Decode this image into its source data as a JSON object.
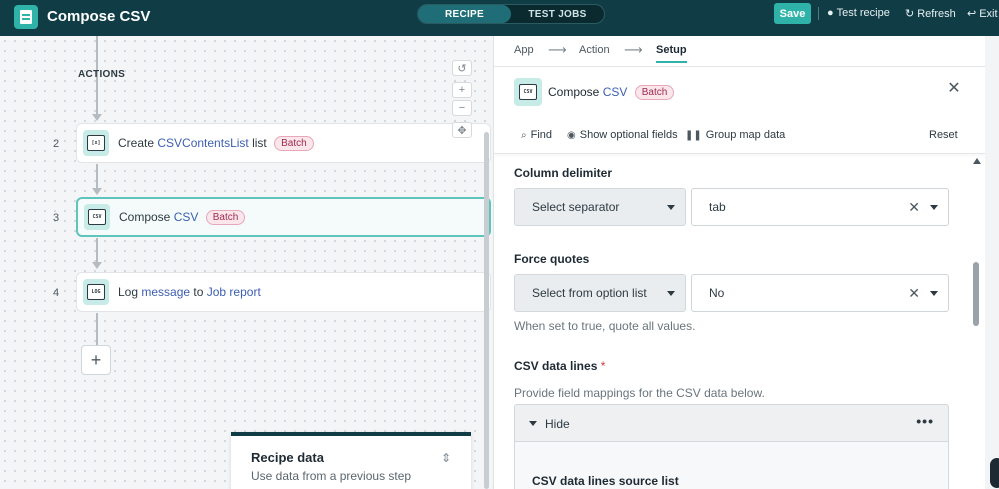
{
  "topbar": {
    "title": "Compose CSV",
    "modes": [
      "RECIPE",
      "TEST JOBS"
    ],
    "active_mode": "RECIPE",
    "save_label": "Save",
    "test_recipe": "Test recipe",
    "refresh": "Refresh",
    "exit": "Exit"
  },
  "canvas": {
    "section_label": "ACTIONS",
    "steps": [
      {
        "num": "2",
        "prefix": "Create ",
        "highlight": "CSVContentsList",
        "suffix": " list",
        "badge": "Batch",
        "icon_text": "[x]"
      },
      {
        "num": "3",
        "prefix": "Compose ",
        "highlight": "CSV",
        "suffix": "",
        "badge": "Batch",
        "icon_text": "CSV"
      },
      {
        "num": "4",
        "prefix": "Log ",
        "highlight": "message",
        "middle": " to ",
        "highlight2": "Job report",
        "icon_text": "LOG"
      }
    ],
    "add_label": "+",
    "recipe_data": {
      "title": "Recipe data",
      "subtitle": "Use data from a previous step"
    }
  },
  "panel": {
    "breadcrumbs": [
      "App",
      "Action",
      "Setup"
    ],
    "active_crumb": "Setup",
    "header": {
      "prefix": "Compose ",
      "highlight": "CSV",
      "badge": "Batch"
    },
    "tools": {
      "find": "Find",
      "optional": "Show optional fields",
      "group": "Group map data",
      "reset": "Reset"
    },
    "fields": {
      "column_delimiter": {
        "label": "Column delimiter",
        "mode": "Select separator",
        "value": "tab"
      },
      "force_quotes": {
        "label": "Force quotes",
        "mode": "Select from option list",
        "value": "No",
        "hint": "When set to true, quote all values."
      },
      "csv_data_lines": {
        "label": "CSV data lines",
        "required": "*",
        "hint": "Provide field mappings for the CSV data below.",
        "toggle": "Hide",
        "sub_label": "CSV data lines source list"
      }
    }
  }
}
